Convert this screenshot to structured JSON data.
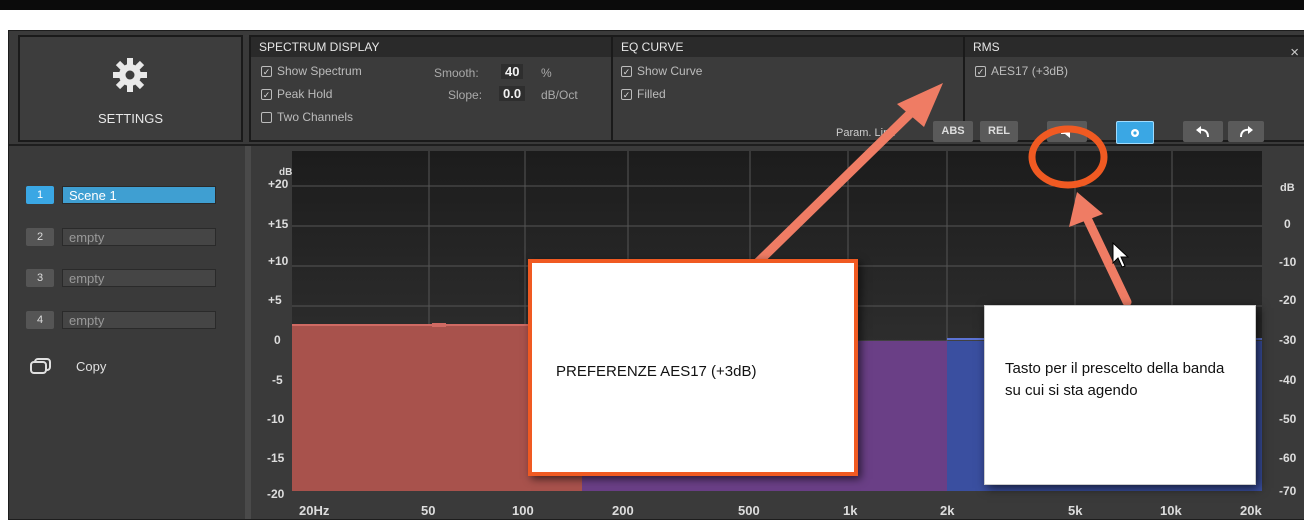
{
  "settings": {
    "label": "SETTINGS"
  },
  "spectrum_display": {
    "title": "SPECTRUM DISPLAY",
    "show_spectrum": "Show Spectrum",
    "peak_hold": "Peak Hold",
    "two_channels": "Two Channels",
    "smooth_label": "Smooth:",
    "smooth_value": "40",
    "smooth_unit": "%",
    "slope_label": "Slope:",
    "slope_value": "0.0",
    "slope_unit": "dB/Oct",
    "checks": {
      "show_spectrum": true,
      "peak_hold": true,
      "two_channels": false
    }
  },
  "eq_curve": {
    "title": "EQ CURVE",
    "show_curve": "Show Curve",
    "filled": "Filled"
  },
  "rms": {
    "title": "RMS",
    "aes17": "AES17 (+3dB)",
    "close": "×"
  },
  "scenes": [
    {
      "num": "1",
      "name": "Scene 1",
      "active": true
    },
    {
      "num": "2",
      "name": "empty",
      "active": false
    },
    {
      "num": "3",
      "name": "empty",
      "active": false
    },
    {
      "num": "4",
      "name": "empty",
      "active": false
    }
  ],
  "copy_label": "Copy",
  "toolbar": {
    "param_link": "Param. Link",
    "abs": "ABS",
    "rel": "REL"
  },
  "chart": {
    "y_unit": "dB",
    "y_ticks": [
      "+20",
      "+15",
      "+10",
      "+5",
      "0",
      "-5",
      "-10",
      "-15",
      "-20"
    ],
    "y_right_ticks": [
      "0",
      "-10",
      "-20",
      "-30",
      "-40",
      "-50",
      "-60",
      "-70"
    ],
    "x_ticks": [
      "20Hz",
      "50",
      "100",
      "200",
      "500",
      "1k",
      "2k",
      "5k",
      "10k",
      "20k"
    ],
    "band_colors": {
      "low": "#a8524c",
      "mid": "#6a3f86",
      "high": "#3a4fa0"
    }
  },
  "callouts": {
    "aes17": "PREFERENZE AES17 (+3dB)",
    "band_button": "Tasto per il prescelto della banda su cui si sta agendo"
  },
  "colors": {
    "accent": "#3aa7e4",
    "annotation": "#f05a22",
    "arrow": "#ef7c64"
  }
}
